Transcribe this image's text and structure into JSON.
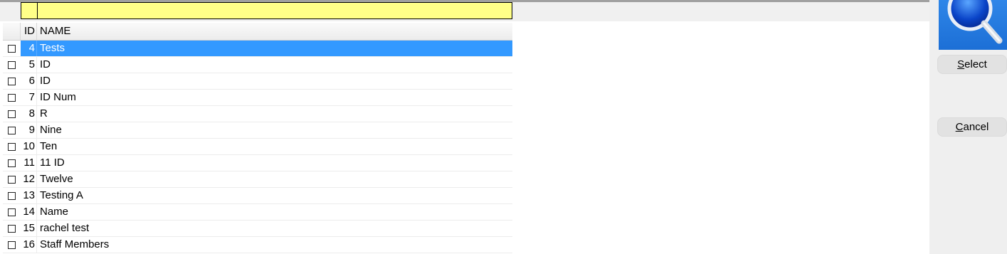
{
  "filter": {
    "id_value": "",
    "name_value": ""
  },
  "grid": {
    "columns": {
      "id": "ID",
      "name": "NAME"
    },
    "selected_id": "4",
    "rows": [
      {
        "id": "4",
        "name": "Tests"
      },
      {
        "id": "5",
        "name": "ID"
      },
      {
        "id": "6",
        "name": "ID"
      },
      {
        "id": "7",
        "name": "ID Num"
      },
      {
        "id": "8",
        "name": "R"
      },
      {
        "id": "9",
        "name": "Nine"
      },
      {
        "id": "10",
        "name": "Ten"
      },
      {
        "id": "11",
        "name": "11 ID"
      },
      {
        "id": "12",
        "name": "Twelve"
      },
      {
        "id": "13",
        "name": "Testing A"
      },
      {
        "id": "14",
        "name": "Name"
      },
      {
        "id": "15",
        "name": "rachel test"
      },
      {
        "id": "16",
        "name": "Staff Members"
      }
    ]
  },
  "actions": {
    "select": {
      "access_key": "S",
      "rest": "elect"
    },
    "cancel": {
      "access_key": "C",
      "rest": "ancel"
    }
  },
  "icons": {
    "search": "magnifier-icon"
  },
  "colors": {
    "selection": "#3399ff",
    "filter_bg": "#ffff88",
    "tile": "#1f74dc"
  }
}
